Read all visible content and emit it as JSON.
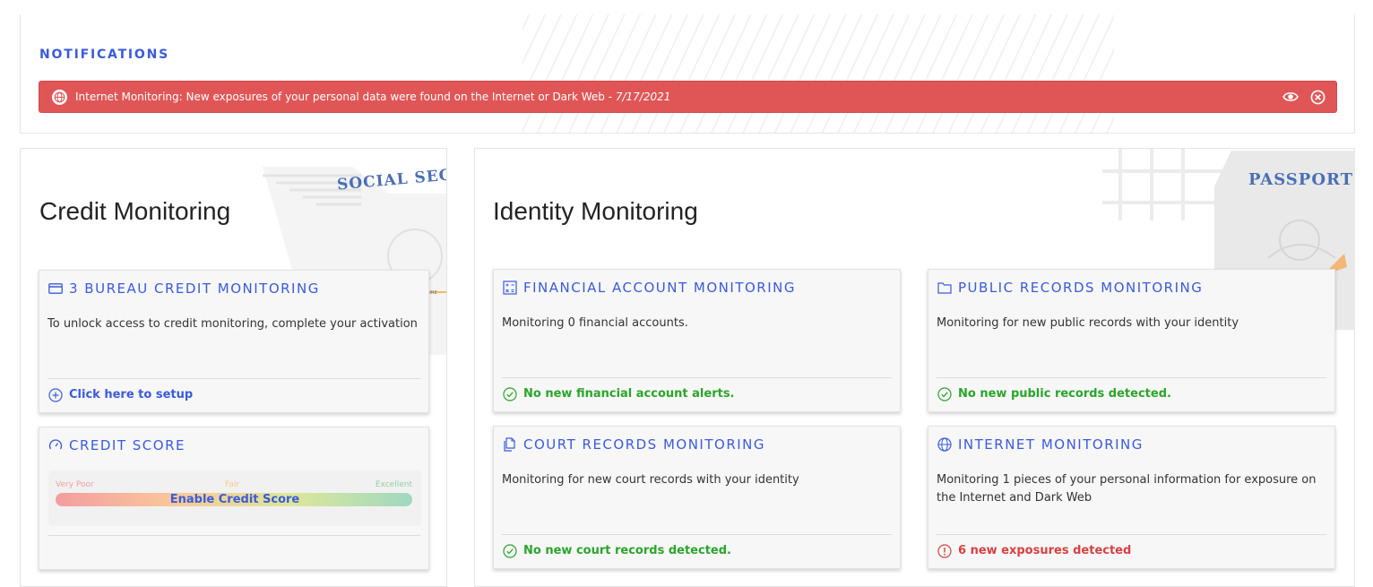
{
  "notifications": {
    "title": "NOTIFICATIONS",
    "alert": {
      "icon": "globe-icon",
      "message": "Internet Monitoring: New exposures of your personal data were found on the Internet or Dark Web - ",
      "date": "7/17/2021",
      "color": "#e05656"
    }
  },
  "credit": {
    "title": "Credit Monitoring",
    "decoration_text": "SOCIAL SEC",
    "decoration_caption": "SIGNATURE",
    "bureau_card": {
      "icon": "credit-card-icon",
      "title": "3 BUREAU CREDIT MONITORING",
      "description": "To unlock access to credit monitoring, complete your activation",
      "footer_icon": "plus-circle-icon",
      "footer": "Click here to setup"
    },
    "score_card": {
      "icon": "gauge-icon",
      "title": "CREDIT SCORE",
      "labels": [
        "Very Poor",
        "Fair",
        "Excellent"
      ],
      "button": "Enable Credit Score"
    }
  },
  "identity": {
    "title": "Identity Monitoring",
    "decoration_text": "PASSPORT",
    "cards": [
      {
        "icon": "calculator-icon",
        "title": "FINANCIAL ACCOUNT MONITORING",
        "description": "Monitoring 0 financial accounts.",
        "status": "No new financial account alerts.",
        "status_type": "ok"
      },
      {
        "icon": "folder-icon",
        "title": "PUBLIC RECORDS MONITORING",
        "description": "Monitoring for new public records with your identity",
        "status": "No new public records detected.",
        "status_type": "ok"
      },
      {
        "icon": "documents-icon",
        "title": "COURT RECORDS MONITORING",
        "description": "Monitoring for new court records with your identity",
        "status": "No new court records detected.",
        "status_type": "ok"
      },
      {
        "icon": "globe-icon",
        "title": "INTERNET MONITORING",
        "description": "Monitoring 1 pieces of your personal information for exposure on the Internet and Dark Web",
        "status": "6 new exposures detected",
        "status_type": "alert"
      }
    ]
  },
  "colors": {
    "accent": "#3b5bdb",
    "ok": "#2aa52a",
    "alert": "#d94040"
  }
}
